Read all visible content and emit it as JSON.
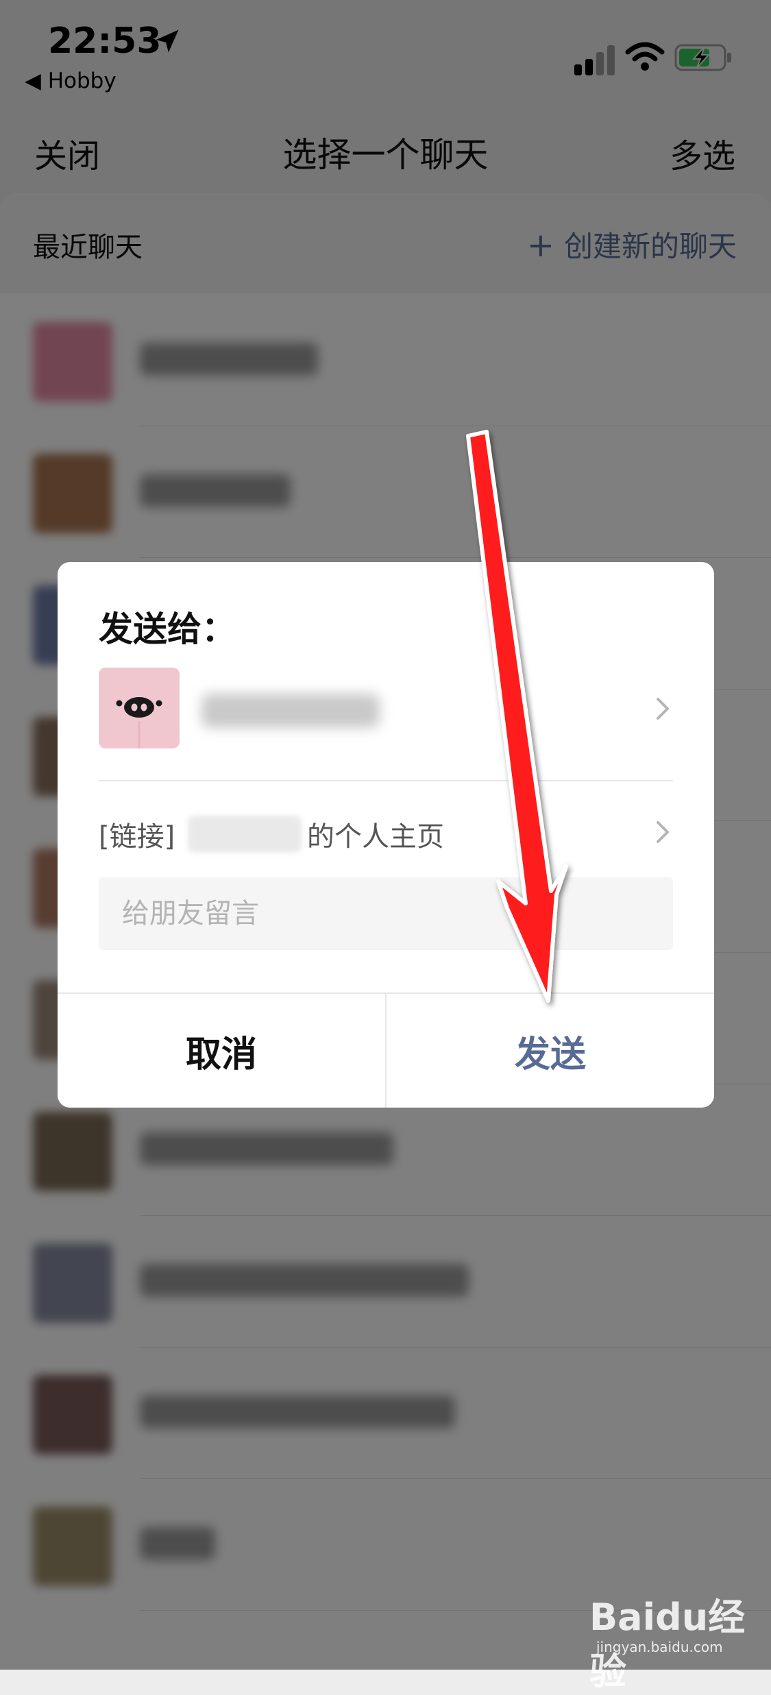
{
  "status_bar": {
    "time": "22:53",
    "back_app": "Hobby"
  },
  "nav": {
    "close": "关闭",
    "title": "选择一个聊天",
    "multi_select": "多选"
  },
  "section": {
    "title": "最近聊天",
    "create": "创建新的聊天"
  },
  "dialog": {
    "title": "发送给：",
    "link_prefix": "[链接]",
    "link_suffix": "的个人主页",
    "message_placeholder": "给朋友留言",
    "cancel": "取消",
    "send": "发送"
  },
  "watermark": {
    "logo": "Baidu经验",
    "url": "jingyan.baidu.com"
  },
  "colors": {
    "accent": "#576b95",
    "annotation_arrow": "#ff1a1a",
    "pig_avatar": "#f1c7cf"
  }
}
